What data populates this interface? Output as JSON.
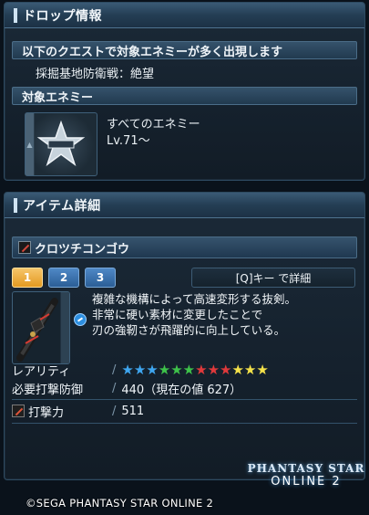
{
  "drop_panel": {
    "title": "ドロップ情報",
    "quest_header": "以下のクエストで対象エネミーが多く出現します",
    "quest_name": "採掘基地防衛戦：絶望",
    "enemy_header": "対象エネミー",
    "enemy_name": "すべてのエネミー",
    "enemy_level": "Lv.71〜"
  },
  "item_panel": {
    "title": "アイテム詳細",
    "item_name": "クロツチコンゴウ",
    "tabs": [
      {
        "label": "1",
        "active": true
      },
      {
        "label": "2",
        "active": false
      },
      {
        "label": "3",
        "active": false
      }
    ],
    "detail_button": "[Q]キー で詳細",
    "description": [
      "複雑な機構によって高速変形する抜剣。",
      "非常に硬い素材に変更したことで",
      "刃の強靭さが飛躍的に向上している。"
    ],
    "rarity_label": "レアリティ",
    "rarity_stars": [
      "#3fa6f0",
      "#3fa6f0",
      "#3fa6f0",
      "#3ec24a",
      "#3ec24a",
      "#3ec24a",
      "#e0393b",
      "#e0393b",
      "#e0393b",
      "#f5e24a",
      "#f5e24a",
      "#f5e24a"
    ],
    "req_label": "必要打撃防御",
    "req_value": "440（現在の値 627）",
    "attack_label": "打撃力",
    "attack_value": "511"
  },
  "footer": {
    "copyright": "©SEGA PHANTASY STAR ONLINE 2",
    "logo_top": "PHANTASY STAR",
    "logo_bottom": "ONLINE 2"
  }
}
